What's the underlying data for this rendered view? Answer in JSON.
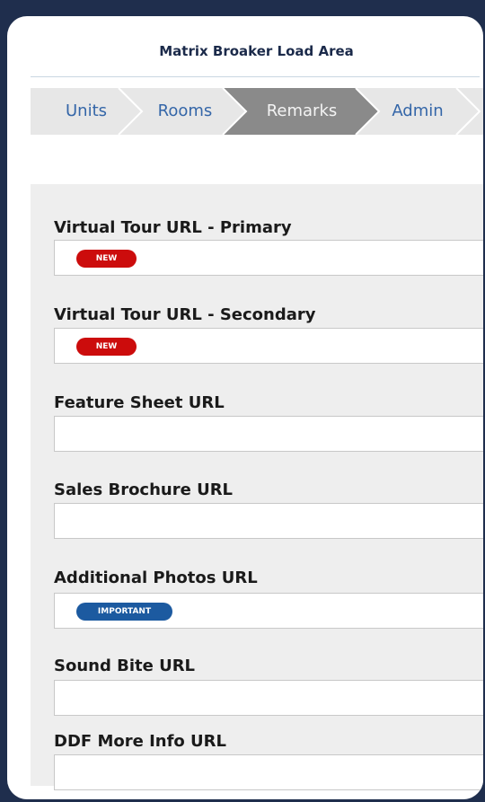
{
  "header": {
    "title": "Matrix Broaker Load Area"
  },
  "tabs": [
    {
      "label": "Units",
      "active": false
    },
    {
      "label": "Rooms",
      "active": false
    },
    {
      "label": "Remarks",
      "active": true
    },
    {
      "label": "Admin",
      "active": false
    }
  ],
  "fields": [
    {
      "label": "Virtual Tour URL - Primary",
      "badge": "NEW"
    },
    {
      "label": "Virtual Tour URL - Secondary",
      "badge": "NEW"
    },
    {
      "label": "Feature Sheet URL",
      "badge": ""
    },
    {
      "label": "Sales Brochure URL",
      "badge": ""
    },
    {
      "label": "Additional Photos URL",
      "badge": "IMPORTANT"
    },
    {
      "label": "Sound Bite URL",
      "badge": ""
    },
    {
      "label": "DDF More Info URL",
      "badge": ""
    }
  ],
  "colors": {
    "background": "#1f2e4d",
    "tab_inactive": "#e7e7e7",
    "tab_active": "#8a8a8a",
    "tab_text": "#3466a8",
    "badge_new": "#cc0c0c",
    "badge_important": "#1c5aa0"
  }
}
